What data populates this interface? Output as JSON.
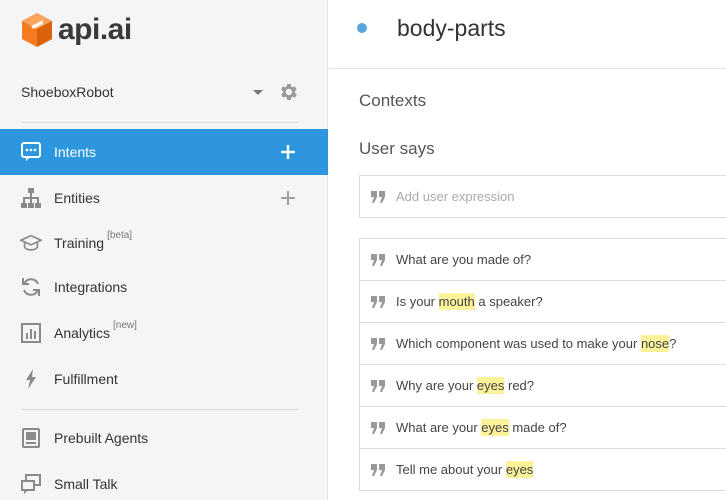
{
  "brand": {
    "name": "api.ai",
    "logo_color": "#f47b20"
  },
  "agent": {
    "name": "ShoeboxRobot"
  },
  "sidebar": {
    "items": [
      {
        "label": "Intents",
        "sup": "",
        "icon": "chat-bubble-icon",
        "active": true,
        "add": true
      },
      {
        "label": "Entities",
        "sup": "",
        "icon": "sitemap-icon",
        "active": false,
        "add": true
      },
      {
        "label": "Training",
        "sup": "[beta]",
        "icon": "graduation-cap-icon",
        "active": false,
        "add": false
      },
      {
        "label": "Integrations",
        "sup": "",
        "icon": "refresh-icon",
        "active": false,
        "add": false
      },
      {
        "label": "Analytics",
        "sup": "[new]",
        "icon": "bar-chart-icon",
        "active": false,
        "add": false
      },
      {
        "label": "Fulfillment",
        "sup": "",
        "icon": "bolt-icon",
        "active": false,
        "add": false
      },
      {
        "label": "Prebuilt Agents",
        "sup": "",
        "icon": "book-icon",
        "active": false,
        "add": false
      },
      {
        "label": "Small Talk",
        "sup": "",
        "icon": "chat-icon",
        "active": false,
        "add": false
      }
    ],
    "active_color": "#2c97de"
  },
  "intent": {
    "title": "body-parts"
  },
  "sections": {
    "contexts": "Contexts",
    "user_says": "User says"
  },
  "expression_input": {
    "placeholder": "Add user expression",
    "value": ""
  },
  "expressions": [
    [
      {
        "t": "What are you made of?"
      }
    ],
    [
      {
        "t": "Is your "
      },
      {
        "t": "mouth",
        "hl": true
      },
      {
        "t": " a speaker?"
      }
    ],
    [
      {
        "t": "Which component was used to make your "
      },
      {
        "t": "nose",
        "hl": true
      },
      {
        "t": "?"
      }
    ],
    [
      {
        "t": "Why are your "
      },
      {
        "t": "eyes",
        "hl": true
      },
      {
        "t": " red?"
      }
    ],
    [
      {
        "t": "What are your "
      },
      {
        "t": "eyes",
        "hl": true
      },
      {
        "t": " made of?"
      }
    ],
    [
      {
        "t": "Tell me about your "
      },
      {
        "t": "eyes",
        "hl": true
      }
    ]
  ],
  "highlight_color": "#fbf29a"
}
